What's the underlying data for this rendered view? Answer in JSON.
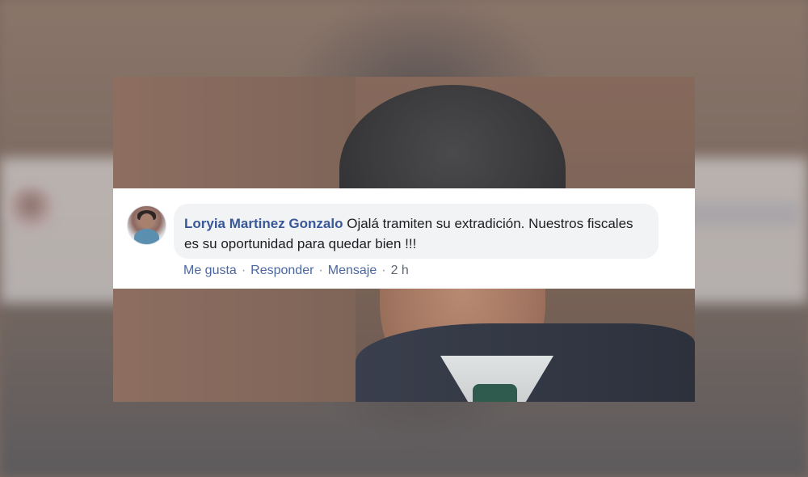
{
  "comment": {
    "author": "Loryia Martinez Gonzalo",
    "text": "Ojalá tramiten su extradición. Nuestros fiscales es su oportunidad para quedar bien !!!",
    "actions": {
      "like": "Me gusta",
      "reply": "Responder",
      "message": "Mensaje",
      "separator": "·",
      "time": "2 h"
    }
  },
  "colors": {
    "author_name": "#385898",
    "action_link": "#4b67a1",
    "bubble_bg": "#f2f3f5",
    "text": "#1c1e21"
  }
}
